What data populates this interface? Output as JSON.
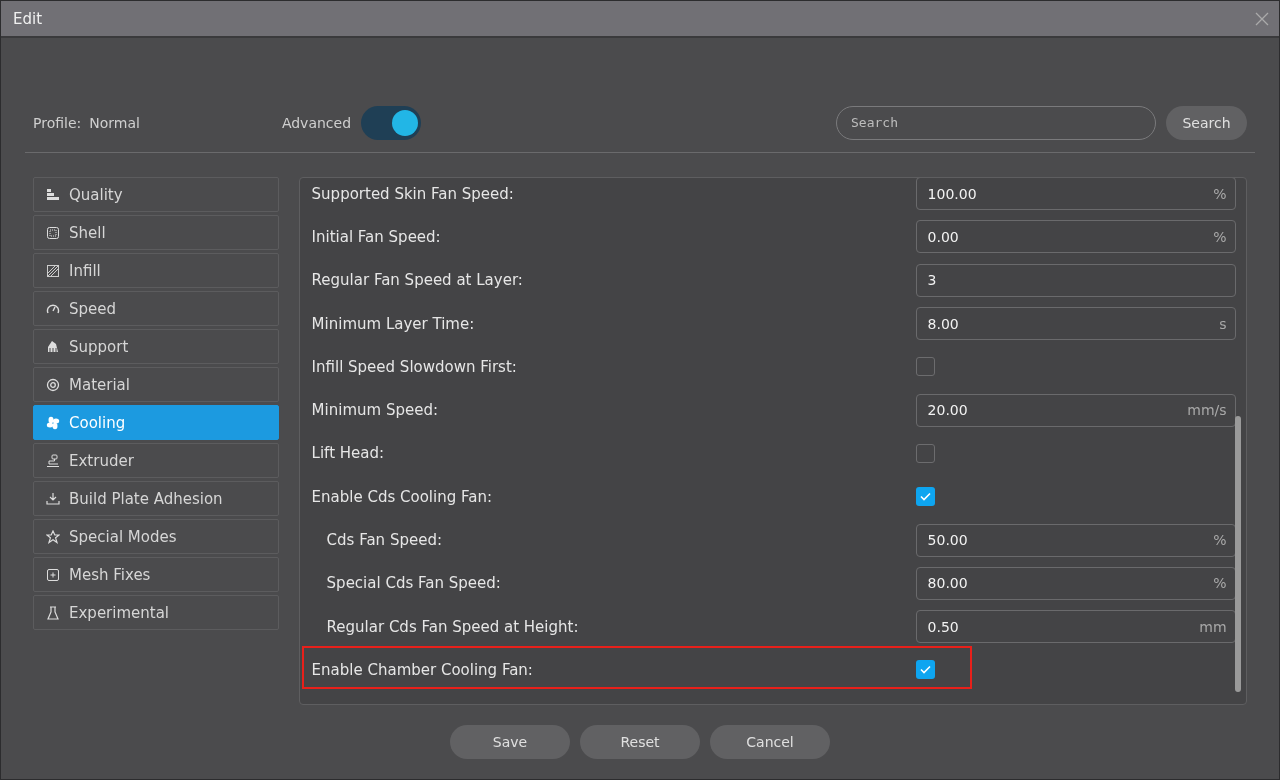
{
  "window": {
    "title": "Edit"
  },
  "header": {
    "profile_label": "Profile:",
    "profile_value": "Normal",
    "advanced_label": "Advanced",
    "advanced_on": true,
    "search_placeholder": "Search",
    "search_button": "Search"
  },
  "sidebar": {
    "items": [
      {
        "label": "Quality",
        "selected": false
      },
      {
        "label": "Shell",
        "selected": false
      },
      {
        "label": "Infill",
        "selected": false
      },
      {
        "label": "Speed",
        "selected": false
      },
      {
        "label": "Support",
        "selected": false
      },
      {
        "label": "Material",
        "selected": false
      },
      {
        "label": "Cooling",
        "selected": true
      },
      {
        "label": "Extruder",
        "selected": false
      },
      {
        "label": "Build Plate Adhesion",
        "selected": false
      },
      {
        "label": "Special Modes",
        "selected": false
      },
      {
        "label": "Mesh Fixes",
        "selected": false
      },
      {
        "label": "Experimental",
        "selected": false
      }
    ]
  },
  "settings": [
    {
      "kind": "number",
      "label": "Supported Skin Fan Speed:",
      "value": "100.00",
      "unit": "%"
    },
    {
      "kind": "number",
      "label": "Initial Fan Speed:",
      "value": "0.00",
      "unit": "%"
    },
    {
      "kind": "number",
      "label": "Regular Fan Speed at Layer:",
      "value": "3"
    },
    {
      "kind": "number",
      "label": "Minimum Layer Time:",
      "value": "8.00",
      "unit": "s"
    },
    {
      "kind": "checkbox",
      "label": "Infill Speed Slowdown First:",
      "checked": false
    },
    {
      "kind": "number",
      "label": "Minimum Speed:",
      "value": "20.00",
      "unit": "mm/s"
    },
    {
      "kind": "checkbox",
      "label": "Lift Head:",
      "checked": false
    },
    {
      "kind": "checkbox",
      "label": "Enable Cds Cooling Fan:",
      "checked": true,
      "children": [
        {
          "kind": "number",
          "label": "Cds Fan Speed:",
          "value": "50.00",
          "unit": "%"
        },
        {
          "kind": "number",
          "label": "Special Cds Fan Speed:",
          "value": "80.00",
          "unit": "%"
        },
        {
          "kind": "number",
          "label": "Regular Cds Fan Speed at Height:",
          "value": "0.50",
          "unit": "mm"
        }
      ]
    },
    {
      "kind": "checkbox",
      "label": "Enable Chamber Cooling Fan:",
      "checked": true,
      "highlighted": true
    }
  ],
  "buttons": [
    "Save",
    "Reset",
    "Cancel"
  ]
}
